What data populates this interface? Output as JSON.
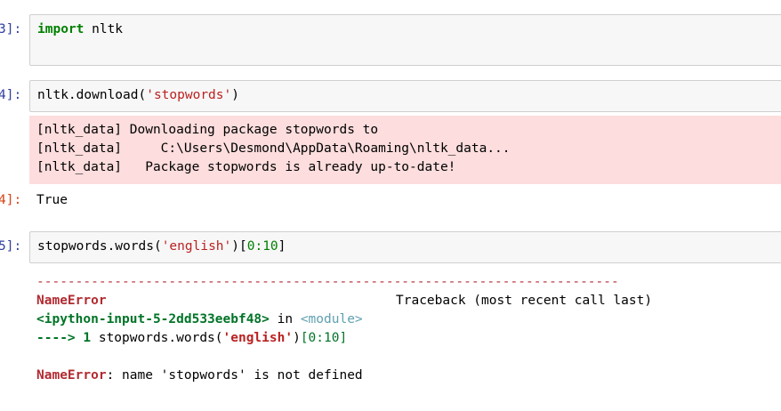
{
  "cells": {
    "c1": {
      "prompt": "3]:",
      "code_kw": "import",
      "code_rest": " nltk"
    },
    "c2": {
      "prompt": "4]:",
      "code_pre": "nltk.download(",
      "code_str": "'stopwords'",
      "code_post": ")",
      "stderr_lines": [
        "[nltk_data] Downloading package stopwords to",
        "[nltk_data]     C:\\Users\\Desmond\\AppData\\Roaming\\nltk_data...",
        "[nltk_data]   Package stopwords is already up-to-date!"
      ],
      "out_prompt": "4]:",
      "out_text": "True"
    },
    "c3": {
      "prompt": "5]:",
      "code_pre": "stopwords.words(",
      "code_str": "'english'",
      "code_post": ")",
      "code_idx_open": "[",
      "code_idx_num": "0:10",
      "code_idx_close": "]",
      "error": {
        "dashes": "---------------------------------------------------------------------------",
        "ename": "NameError",
        "traceback_label": "Traceback (most recent call last)",
        "input_ref": "<ipython-input-5-2dd533eebf48>",
        "in_word": " in ",
        "module": "<module>",
        "arrow": "----> 1",
        "line_pre": " stopwords.words(",
        "line_str": "'english'",
        "line_post": ")",
        "line_idx": "[0:10]",
        "final_name": "NameError",
        "final_msg": ": name 'stopwords' is not defined"
      }
    }
  }
}
